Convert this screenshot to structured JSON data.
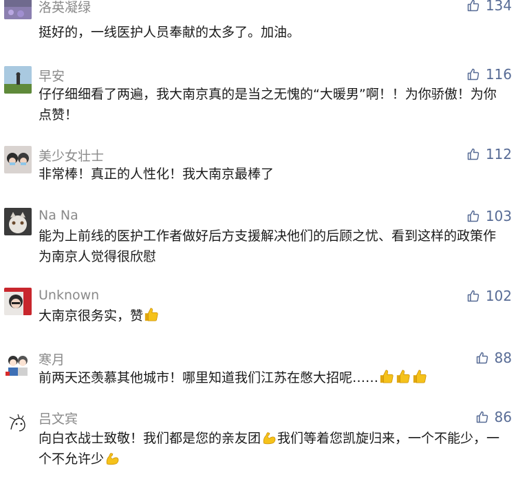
{
  "comments": [
    {
      "name": "洛英凝绿",
      "likes": "134",
      "text_parts": [
        "挺好的，一线医护人员奉献的太多了。加油。"
      ]
    },
    {
      "name": "早安",
      "likes": "116",
      "text_parts": [
        "仔仔细细看了两遍，我大南京真的是当之无愧的“大暖男”啊！！为你骄傲！为你点赞！"
      ]
    },
    {
      "name": "美少女壮士",
      "likes": "112",
      "text_parts": [
        "非常棒！真正的人性化！我大南京最棒了"
      ]
    },
    {
      "name": "Na Na",
      "likes": "103",
      "text_parts": [
        "能为上前线的医护工作者做好后方支援解决他们的后顾之忧、看到这样的政策作为南京人觉得很欣慰"
      ]
    },
    {
      "name": "Unknown",
      "likes": "102",
      "text_parts": [
        "大南京很务实，赞"
      ]
    },
    {
      "name": "寒月",
      "likes": "88",
      "text_parts": [
        "前两天还羡慕其他城市！哪里知道我们江苏在憋大招呢……"
      ]
    },
    {
      "name": "吕文宾",
      "likes": "86",
      "text_parts": [
        "向白衣战士致敬！我们都是您的亲友团",
        "我们等着您凯旋归来，一个不能少，一个不允许少"
      ]
    }
  ],
  "icons": {
    "like": "thumb-up-outline-icon",
    "emoji_thumb": "thumbs-up-emoji-icon",
    "emoji_muscle": "flexed-biceps-emoji-icon"
  },
  "colors": {
    "like_blue": "#576b95",
    "name_gray": "#8a8a8a",
    "emoji_yellow": "#f5c21b"
  }
}
